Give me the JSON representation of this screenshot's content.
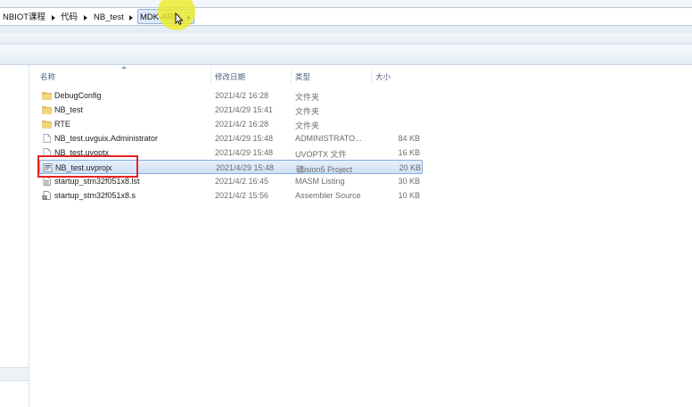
{
  "breadcrumb": {
    "items": [
      {
        "label": "NBIOT课程"
      },
      {
        "label": "代码"
      },
      {
        "label": "NB_test"
      },
      {
        "label": "MDK-ARM"
      }
    ]
  },
  "columns": {
    "name": "名称",
    "date": "修改日期",
    "type": "类型",
    "size": "大小"
  },
  "files": [
    {
      "name": "DebugConfig",
      "date": "2021/4/2 16:28",
      "type": "文件夹",
      "size": "",
      "icon": "folder-icon"
    },
    {
      "name": "NB_test",
      "date": "2021/4/29 15:41",
      "type": "文件夹",
      "size": "",
      "icon": "folder-icon"
    },
    {
      "name": "RTE",
      "date": "2021/4/2 16:28",
      "type": "文件夹",
      "size": "",
      "icon": "folder-icon"
    },
    {
      "name": "NB_test.uvguix.Administrator",
      "date": "2021/4/29 15:48",
      "type": "ADMINISTRATO...",
      "size": "84 KB",
      "icon": "file-icon"
    },
    {
      "name": "NB_test.uvoptx",
      "date": "2021/4/29 15:48",
      "type": "UVOPTX 文件",
      "size": "16 KB",
      "icon": "file-icon"
    },
    {
      "name": "NB_test.uvprojx",
      "date": "2021/4/29 15:48",
      "type": "礦ision5 Project",
      "size": "20 KB",
      "icon": "keil-project-icon",
      "selected": true
    },
    {
      "name": "startup_stm32f051x8.lst",
      "date": "2021/4/2 16:45",
      "type": "MASM Listing",
      "size": "30 KB",
      "icon": "listing-file-icon"
    },
    {
      "name": "startup_stm32f051x8.s",
      "date": "2021/4/2 15:56",
      "type": "Assembler Source",
      "size": "10 KB",
      "icon": "assembler-file-icon"
    }
  ],
  "colors": {
    "selection": "#cfe1f6",
    "highlight_box": "#e82121",
    "cursor_highlight": "#ecec28",
    "folder": "#e8c25a"
  }
}
